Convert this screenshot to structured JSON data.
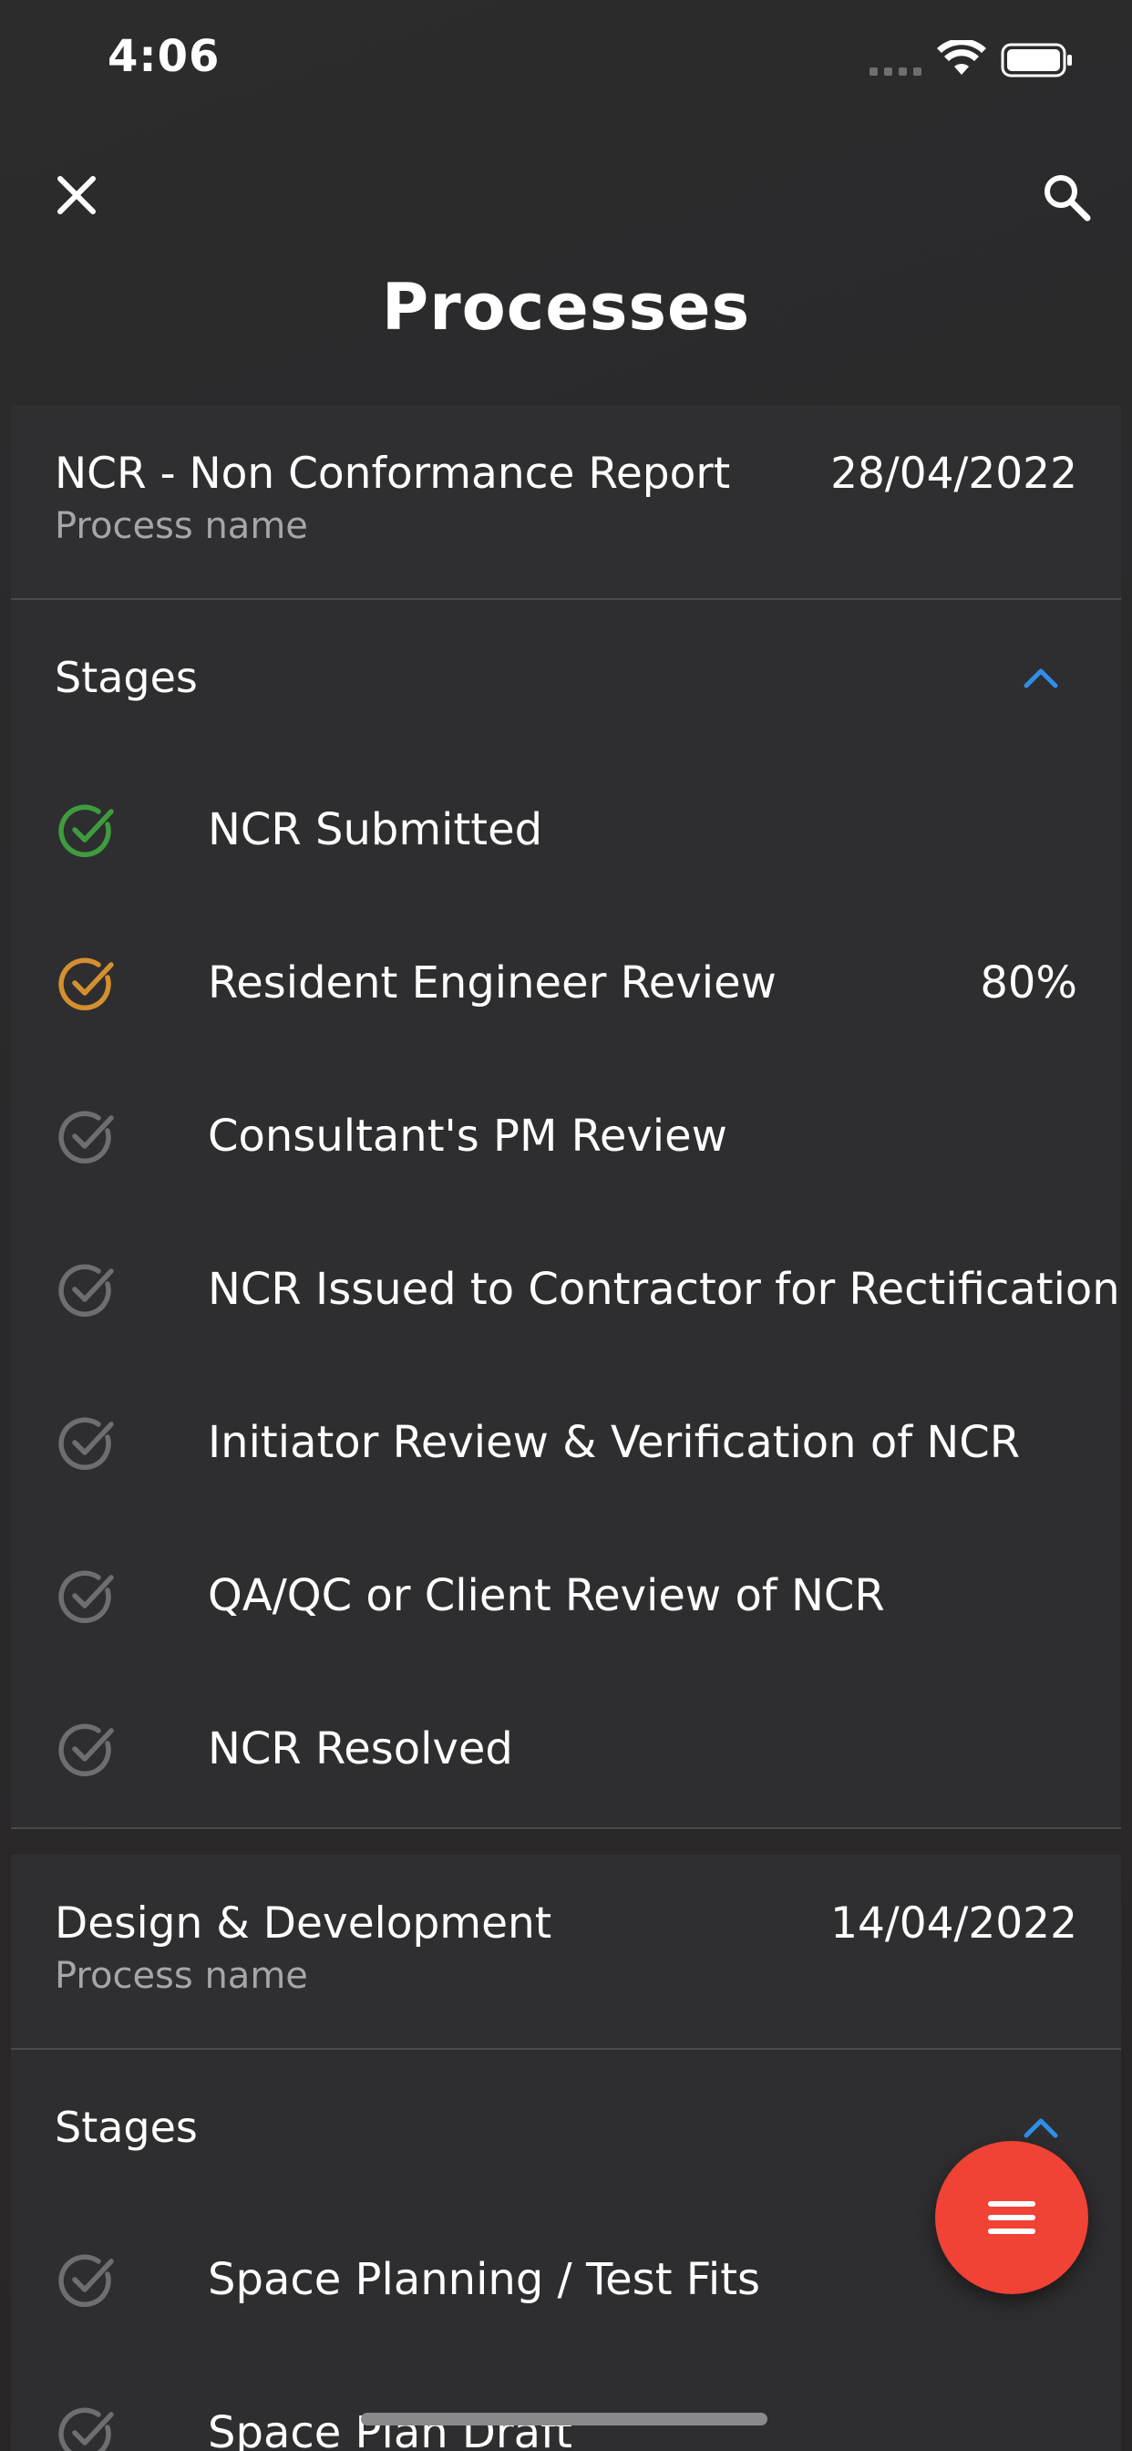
{
  "status_bar": {
    "time": "4:06"
  },
  "header": {
    "title": "Processes"
  },
  "colors": {
    "done": "#3f9c3e",
    "in_progress": "#d4902f",
    "pending": "#6e6e70",
    "accent": "#2f8ee8",
    "fab": "#f04235"
  },
  "icons": {
    "close": "close-icon",
    "search": "search-icon",
    "collapse": "chevron-up-icon",
    "stage": "check-circle-icon",
    "fab": "menu-icon"
  },
  "processes": [
    {
      "name": "NCR - Non Conformance Report",
      "subtitle": "Process name",
      "date": "28/04/2022",
      "stages_label": "Stages",
      "stages": [
        {
          "label": "NCR Submitted",
          "status": "done",
          "percent": ""
        },
        {
          "label": "Resident Engineer Review",
          "status": "in_progress",
          "percent": "80%"
        },
        {
          "label": "Consultant's PM Review",
          "status": "pending",
          "percent": ""
        },
        {
          "label": "NCR Issued to Contractor for Rectification",
          "status": "pending",
          "percent": ""
        },
        {
          "label": "Initiator Review & Verification of NCR",
          "status": "pending",
          "percent": ""
        },
        {
          "label": "QA/QC or Client Review of NCR",
          "status": "pending",
          "percent": ""
        },
        {
          "label": "NCR Resolved",
          "status": "pending",
          "percent": ""
        }
      ]
    },
    {
      "name": "Design & Development",
      "subtitle": "Process name",
      "date": "14/04/2022",
      "stages_label": "Stages",
      "stages": [
        {
          "label": "Space Planning / Test Fits",
          "status": "pending",
          "percent": ""
        },
        {
          "label": "Space Plan Draft",
          "status": "pending",
          "percent": ""
        }
      ]
    }
  ]
}
